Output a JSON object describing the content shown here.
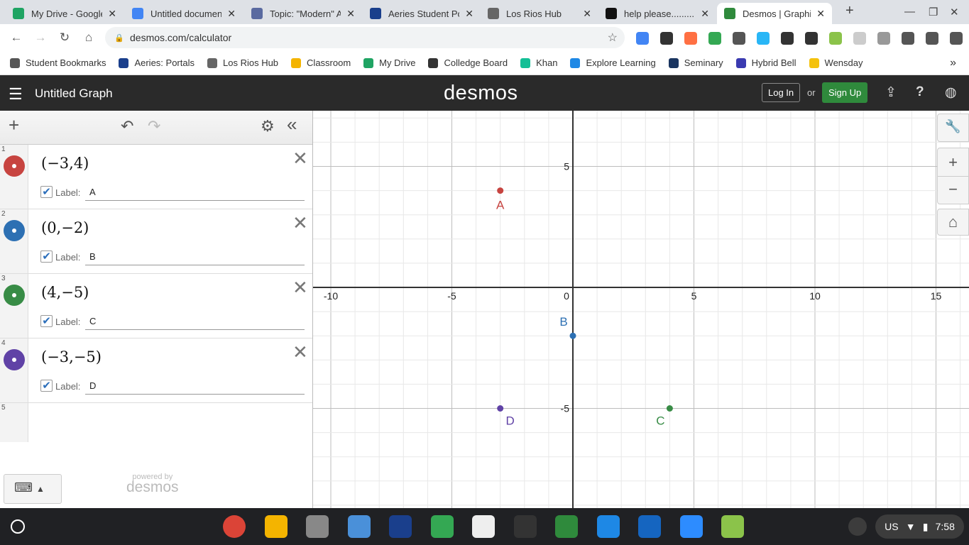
{
  "tabs": [
    {
      "title": "My Drive - Google",
      "color": "#1fa463"
    },
    {
      "title": "Untitled documen",
      "color": "#4285f4"
    },
    {
      "title": "Topic: \"Modern\" A",
      "color": "#5a6aa0"
    },
    {
      "title": "Aeries Student Po",
      "color": "#1a3f8c"
    },
    {
      "title": "Los Rios Hub",
      "color": "#666"
    },
    {
      "title": "help please.........",
      "color": "#111"
    },
    {
      "title": "Desmos | Graphin",
      "color": "#2f8a3c"
    }
  ],
  "url": "desmos.com/calculator",
  "bookmarks": [
    {
      "label": "Student Bookmarks",
      "color": "#555"
    },
    {
      "label": "Aeries: Portals",
      "color": "#1a3f8c"
    },
    {
      "label": "Los Rios Hub",
      "color": "#666"
    },
    {
      "label": "Classroom",
      "color": "#f4b400"
    },
    {
      "label": "My Drive",
      "color": "#1fa463"
    },
    {
      "label": "Colledge Board",
      "color": "#333"
    },
    {
      "label": "Khan",
      "color": "#14bf96"
    },
    {
      "label": "Explore Learning",
      "color": "#1e88e5"
    },
    {
      "label": "Seminary",
      "color": "#1a3560"
    },
    {
      "label": "Hybrid Bell",
      "color": "#3a3ab0"
    },
    {
      "label": "Wensday",
      "color": "#f4c20d"
    }
  ],
  "header": {
    "title": "Untitled Graph",
    "logo": "desmos",
    "login": "Log In",
    "or": "or",
    "signup": "Sign Up"
  },
  "expressions": [
    {
      "num": "1",
      "math": "(−3,4)",
      "label_text": "Label:",
      "label": "A",
      "color": "#c74440",
      "x": -3,
      "y": 4
    },
    {
      "num": "2",
      "math": "(0,−2)",
      "label_text": "Label:",
      "label": "B",
      "color": "#2d70b3",
      "x": 0,
      "y": -2
    },
    {
      "num": "3",
      "math": "(4,−5)",
      "label_text": "Label:",
      "label": "C",
      "color": "#388c46",
      "x": 4,
      "y": -5
    },
    {
      "num": "4",
      "math": "(−3,−5)",
      "label_text": "Label:",
      "label": "D",
      "color": "#6042a6",
      "x": -3,
      "y": -5
    }
  ],
  "empty_num": "5",
  "powered_by": "powered by",
  "powered_logo": "desmos",
  "axis": {
    "x_ticks": [
      "-10",
      "-5",
      "0",
      "5",
      "10",
      "15"
    ],
    "y_ticks": [
      "5",
      "-5"
    ],
    "x_range": [
      -10.9,
      16.3
    ],
    "y_range": [
      -9.1,
      7.4
    ]
  },
  "tray": {
    "lang": "US",
    "time": "7:58"
  }
}
